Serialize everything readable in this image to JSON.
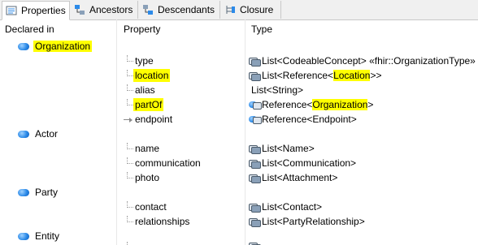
{
  "tabs": [
    {
      "label": "Properties",
      "icon": "properties-icon",
      "active": true
    },
    {
      "label": "Ancestors",
      "icon": "ancestors-icon"
    },
    {
      "label": "Descendants",
      "icon": "descendants-icon"
    },
    {
      "label": "Closure",
      "icon": "closure-icon"
    }
  ],
  "columns": {
    "declared_in": "Declared in",
    "property": "Property",
    "type": "Type"
  },
  "groups": {
    "organization": {
      "name": "Organization",
      "rows": [
        {
          "property": "type",
          "type": "List<CodeableConcept> «fhir::OrganizationType»"
        },
        {
          "property": "location",
          "type_pre": "List<Reference<",
          "type_hl": "Location",
          "type_post": ">>"
        },
        {
          "property": "alias",
          "type": "List<String>"
        },
        {
          "property": "partOf",
          "type_pre": "Reference<",
          "type_hl": "Organization",
          "type_post": ">"
        },
        {
          "property": "endpoint",
          "type": "Reference<Endpoint>"
        }
      ]
    },
    "actor": {
      "name": "Actor",
      "rows": [
        {
          "property": "name",
          "type": "List<Name>"
        },
        {
          "property": "communication",
          "type": "List<Communication>"
        },
        {
          "property": "photo",
          "type": "List<Attachment>"
        }
      ]
    },
    "party": {
      "name": "Party",
      "rows": [
        {
          "property": "contact",
          "type": "List<Contact>"
        },
        {
          "property": "relationships",
          "type": "List<PartyRelationship>"
        }
      ]
    },
    "entity": {
      "name": "Entity"
    }
  },
  "colors": {
    "highlight": "#ffff00",
    "class_icon": "#2c8ae8"
  }
}
